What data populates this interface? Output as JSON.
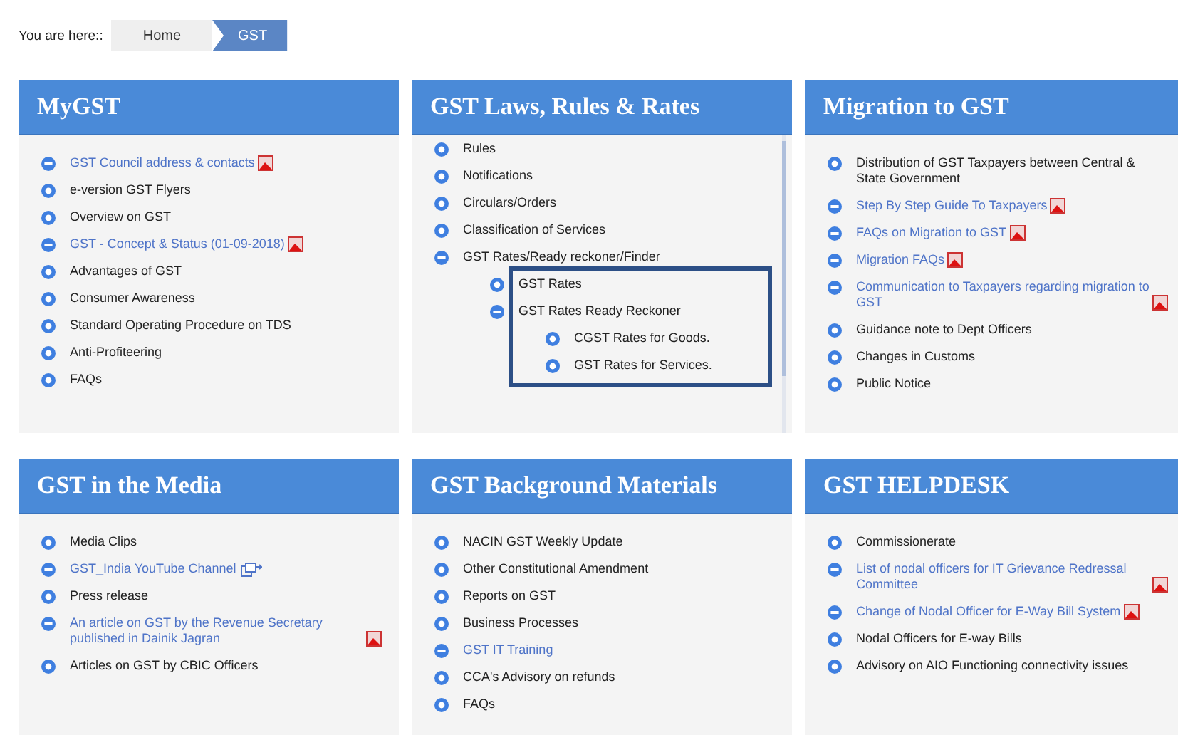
{
  "breadcrumb": {
    "label": "You are here::",
    "crumbs": [
      {
        "label": "Home",
        "selected": false
      },
      {
        "label": "GST",
        "selected": true
      }
    ]
  },
  "panels": [
    {
      "title": "MyGST",
      "scrolled": false,
      "items": [
        {
          "label": "GST Council address & contacts",
          "kind": "link",
          "pdf": true
        },
        {
          "label": "e-version GST Flyers",
          "kind": "folder",
          "expanded": false
        },
        {
          "label": "Overview on GST",
          "kind": "folder",
          "expanded": false
        },
        {
          "label": "GST - Concept & Status (01-09-2018)",
          "kind": "link",
          "pdf": true
        },
        {
          "label": "Advantages of GST",
          "kind": "folder",
          "expanded": false
        },
        {
          "label": "Consumer Awareness",
          "kind": "folder",
          "expanded": false
        },
        {
          "label": "Standard Operating Procedure on TDS",
          "kind": "folder",
          "expanded": false
        },
        {
          "label": "Anti-Profiteering",
          "kind": "folder",
          "expanded": false
        },
        {
          "label": "FAQs",
          "kind": "folder",
          "expanded": false
        }
      ]
    },
    {
      "title": "GST Laws, Rules & Rates",
      "scrolled": true,
      "items": [
        {
          "label": "Rules",
          "kind": "folder",
          "expanded": false
        },
        {
          "label": "Notifications",
          "kind": "folder",
          "expanded": false
        },
        {
          "label": "Circulars/Orders",
          "kind": "folder",
          "expanded": false
        },
        {
          "label": "Classification of Services",
          "kind": "folder",
          "expanded": false
        },
        {
          "label": "GST Rates/Ready reckoner/Finder",
          "kind": "folder",
          "expanded": true,
          "highlighted": true,
          "children": [
            {
              "label": "GST Rates",
              "kind": "folder",
              "expanded": false
            },
            {
              "label": "GST Rates Ready Reckoner",
              "kind": "folder",
              "expanded": true,
              "children": [
                {
                  "label": "CGST Rates for Goods.",
                  "kind": "folder",
                  "expanded": false
                },
                {
                  "label": "GST Rates for Services.",
                  "kind": "folder",
                  "expanded": false
                }
              ]
            }
          ]
        }
      ]
    },
    {
      "title": "Migration to GST",
      "scrolled": false,
      "items": [
        {
          "label": "Distribution of GST Taxpayers between Central & State Government",
          "kind": "folder",
          "expanded": false
        },
        {
          "label": "Step By Step Guide To Taxpayers",
          "kind": "link",
          "pdf": true
        },
        {
          "label": "FAQs on Migration to GST",
          "kind": "link",
          "pdf": true
        },
        {
          "label": "Migration FAQs",
          "kind": "link",
          "pdf": true
        },
        {
          "label": "Communication to Taxpayers regarding migration to GST",
          "kind": "link",
          "pdf": true
        },
        {
          "label": "Guidance note to Dept Officers",
          "kind": "folder",
          "expanded": false
        },
        {
          "label": "Changes in Customs",
          "kind": "folder",
          "expanded": false
        },
        {
          "label": "Public Notice",
          "kind": "folder",
          "expanded": false
        }
      ]
    },
    {
      "title": "GST in the Media",
      "scrolled": false,
      "items": [
        {
          "label": "Media Clips",
          "kind": "folder",
          "expanded": false
        },
        {
          "label": "GST_India YouTube Channel",
          "kind": "link",
          "external": true
        },
        {
          "label": "Press release",
          "kind": "folder",
          "expanded": false
        },
        {
          "label": "An article on GST by the Revenue Secretary published in Dainik Jagran",
          "kind": "link",
          "pdf": true
        },
        {
          "label": "Articles on GST by CBIC Officers",
          "kind": "folder",
          "expanded": false
        }
      ]
    },
    {
      "title": "GST Background Materials",
      "scrolled": false,
      "items": [
        {
          "label": "NACIN GST Weekly Update",
          "kind": "folder",
          "expanded": false
        },
        {
          "label": "Other Constitutional Amendment",
          "kind": "folder",
          "expanded": false
        },
        {
          "label": "Reports on GST",
          "kind": "folder",
          "expanded": false
        },
        {
          "label": "Business Processes",
          "kind": "folder",
          "expanded": false
        },
        {
          "label": "GST IT Training",
          "kind": "link"
        },
        {
          "label": "CCA's Advisory on refunds",
          "kind": "folder",
          "expanded": false
        },
        {
          "label": "FAQs",
          "kind": "folder",
          "expanded": false
        }
      ]
    },
    {
      "title": "GST HELPDESK",
      "scrolled": false,
      "items": [
        {
          "label": "Commissionerate",
          "kind": "folder",
          "expanded": false
        },
        {
          "label": "List of nodal officers for IT Grievance Redressal Committee",
          "kind": "link",
          "pdf": true
        },
        {
          "label": "Change of Nodal Officer for E-Way Bill System",
          "kind": "link",
          "pdf": true
        },
        {
          "label": "Nodal Officers for E-way Bills",
          "kind": "folder",
          "expanded": false
        },
        {
          "label": "Advisory on AIO Functioning connectivity issues",
          "kind": "folder",
          "expanded": false
        }
      ]
    }
  ]
}
